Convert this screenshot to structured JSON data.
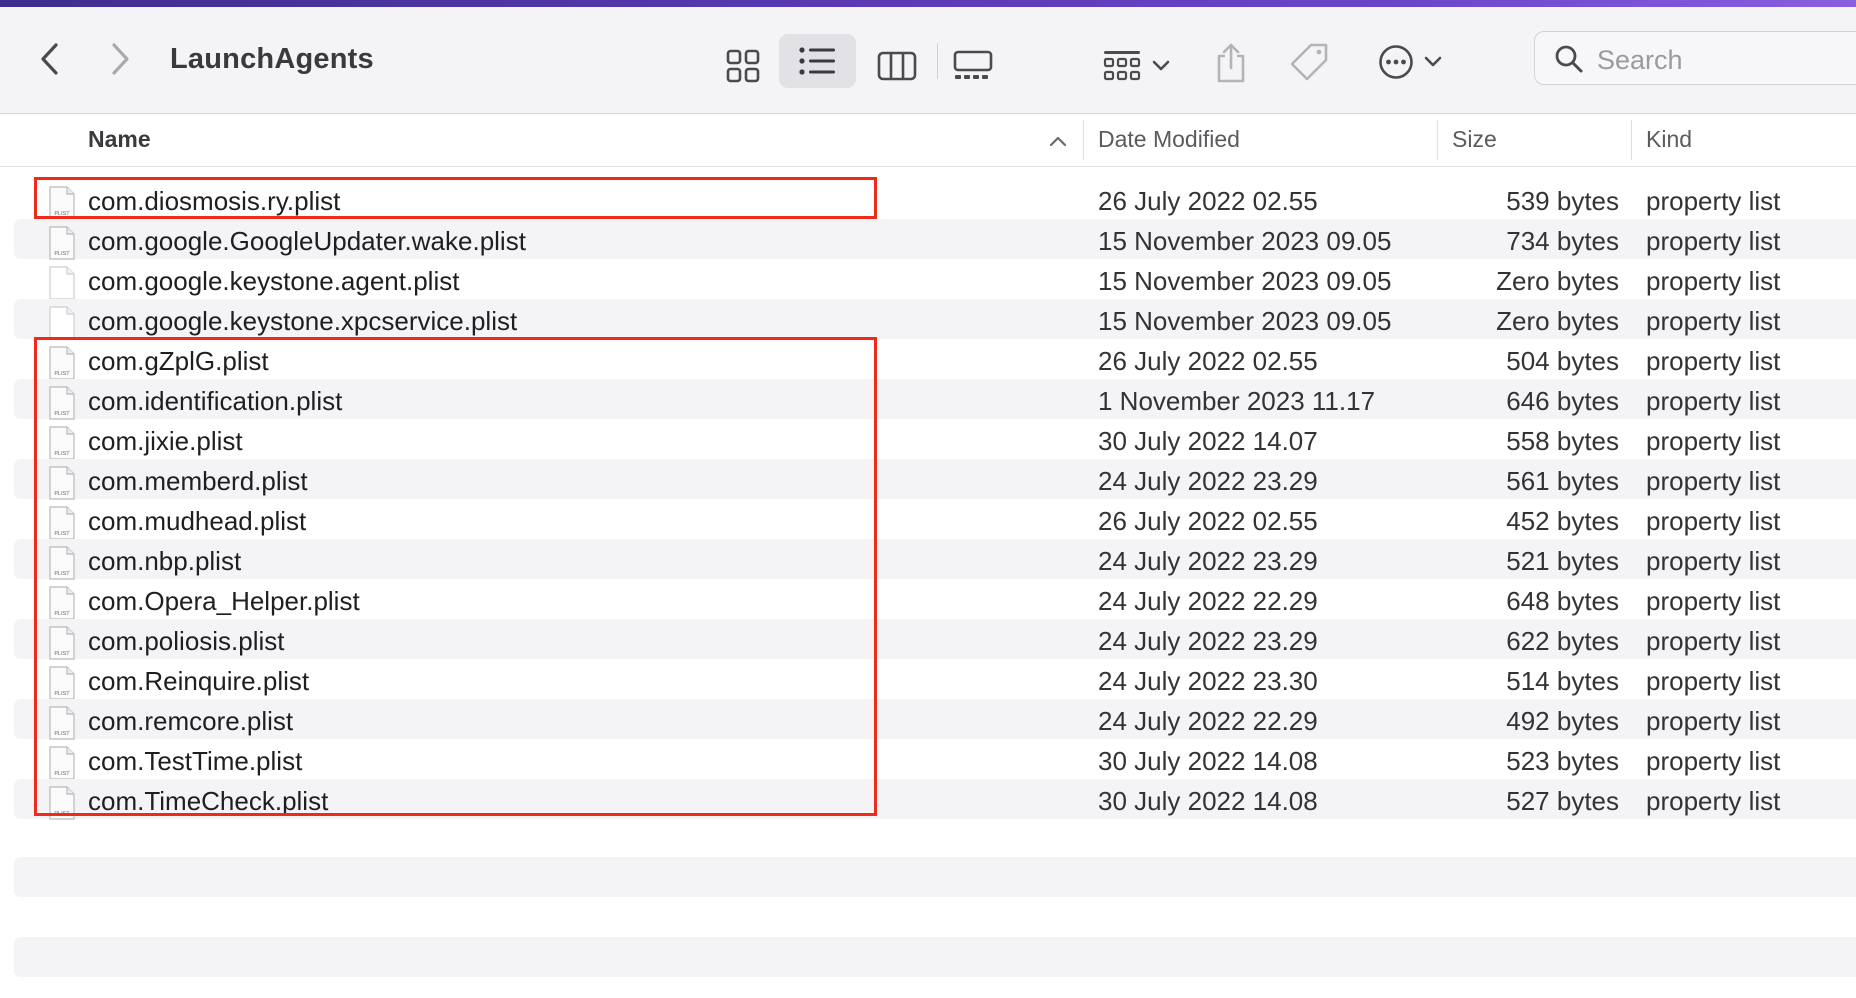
{
  "window": {
    "title": "LaunchAgents"
  },
  "toolbar": {
    "back_icon": "chevron-left-icon",
    "forward_icon": "chevron-right-icon",
    "view_modes": [
      "icon-view",
      "list-view",
      "column-view",
      "gallery-view"
    ],
    "active_view": "list-view",
    "group_icon": "group-by-icon",
    "share_icon": "share-icon",
    "tag_icon": "tag-icon",
    "more_icon": "ellipsis-circle-icon",
    "search_placeholder": "Search"
  },
  "columns": {
    "name": "Name",
    "date": "Date Modified",
    "size": "Size",
    "kind": "Kind",
    "sort_icon": "chevron-up-icon"
  },
  "files": [
    {
      "name": "com.diosmosis.ry.plist",
      "date": "26 July 2022 02.55",
      "size": "539 bytes",
      "kind": "property list",
      "icon": "plist"
    },
    {
      "name": "com.google.GoogleUpdater.wake.plist",
      "date": "15 November 2023 09.05",
      "size": "734 bytes",
      "kind": "property list",
      "icon": "plist"
    },
    {
      "name": "com.google.keystone.agent.plist",
      "date": "15 November 2023 09.05",
      "size": "Zero bytes",
      "kind": "property list",
      "icon": "blank"
    },
    {
      "name": "com.google.keystone.xpcservice.plist",
      "date": "15 November 2023 09.05",
      "size": "Zero bytes",
      "kind": "property list",
      "icon": "blank"
    },
    {
      "name": "com.gZplG.plist",
      "date": "26 July 2022 02.55",
      "size": "504 bytes",
      "kind": "property list",
      "icon": "plist"
    },
    {
      "name": "com.identification.plist",
      "date": "1 November 2023 11.17",
      "size": "646 bytes",
      "kind": "property list",
      "icon": "plist"
    },
    {
      "name": "com.jixie.plist",
      "date": "30 July 2022 14.07",
      "size": "558 bytes",
      "kind": "property list",
      "icon": "plist"
    },
    {
      "name": "com.memberd.plist",
      "date": "24 July 2022 23.29",
      "size": "561 bytes",
      "kind": "property list",
      "icon": "plist"
    },
    {
      "name": "com.mudhead.plist",
      "date": "26 July 2022 02.55",
      "size": "452 bytes",
      "kind": "property list",
      "icon": "plist"
    },
    {
      "name": "com.nbp.plist",
      "date": "24 July 2022 23.29",
      "size": "521 bytes",
      "kind": "property list",
      "icon": "plist"
    },
    {
      "name": "com.Opera_Helper.plist",
      "date": "24 July 2022 22.29",
      "size": "648 bytes",
      "kind": "property list",
      "icon": "plist"
    },
    {
      "name": "com.poliosis.plist",
      "date": "24 July 2022 23.29",
      "size": "622 bytes",
      "kind": "property list",
      "icon": "plist"
    },
    {
      "name": "com.Reinquire.plist",
      "date": "24 July 2022 23.30",
      "size": "514 bytes",
      "kind": "property list",
      "icon": "plist"
    },
    {
      "name": "com.remcore.plist",
      "date": "24 July 2022 22.29",
      "size": "492 bytes",
      "kind": "property list",
      "icon": "plist"
    },
    {
      "name": "com.TestTime.plist",
      "date": "30 July 2022 14.08",
      "size": "523 bytes",
      "kind": "property list",
      "icon": "plist"
    },
    {
      "name": "com.TimeCheck.plist",
      "date": "30 July 2022 14.08",
      "size": "527 bytes",
      "kind": "property list",
      "icon": "plist"
    }
  ],
  "annotations": {
    "highlight_color": "#ee2a1b"
  }
}
